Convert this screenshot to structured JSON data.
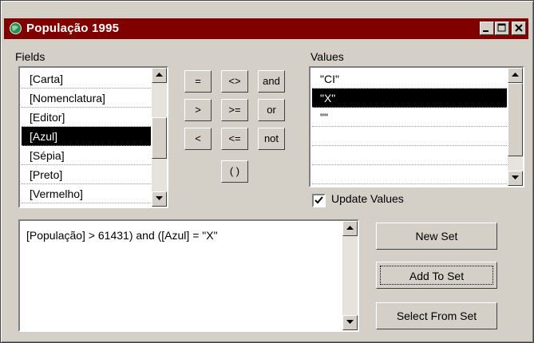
{
  "window": {
    "title": "População 1995"
  },
  "fields": {
    "label": "Fields",
    "items": [
      {
        "label": "[Carta]"
      },
      {
        "label": "[Nomenclatura]"
      },
      {
        "label": "[Editor]"
      },
      {
        "label": "[Azul]",
        "selected": true
      },
      {
        "label": "[Sépia]"
      },
      {
        "label": "[Preto]"
      },
      {
        "label": "[Vermelho]"
      }
    ]
  },
  "operators": {
    "eq": "=",
    "neq": "<>",
    "and": "and",
    "gt": ">",
    "gte": ">=",
    "or": "or",
    "lt": "<",
    "lte": "<=",
    "not": "not",
    "parens": "( )"
  },
  "values": {
    "label": "Values",
    "items": [
      {
        "label": "\"CI\""
      },
      {
        "label": "\"X\"",
        "selected": true
      },
      {
        "label": "\"\""
      },
      {
        "label": ""
      },
      {
        "label": ""
      },
      {
        "label": ""
      }
    ]
  },
  "update_values": {
    "label": "Update Values",
    "checked": true
  },
  "expression": {
    "text": "[População] > 61431) and ([Azul] = \"X\""
  },
  "buttons": {
    "new_set": "New Set",
    "add_to_set": "Add To Set",
    "select_from_set": "Select From Set"
  },
  "colors": {
    "title_bar": "#800000",
    "face": "#d4d0c8",
    "selection": "#000000"
  }
}
